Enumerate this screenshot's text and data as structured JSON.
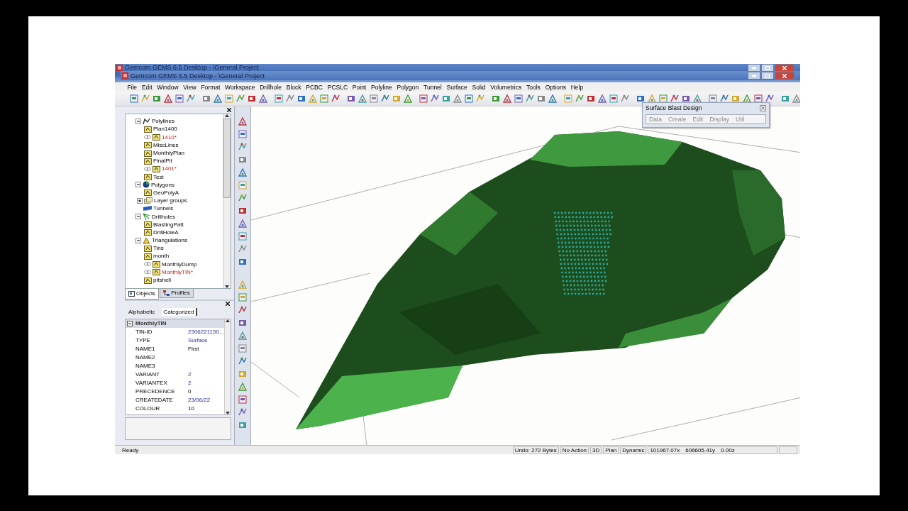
{
  "window": {
    "title_back": "Gemcom GEMS 6.5 Desktop - \\General Project",
    "title": "Gemcom GEMS 6.5 Desktop - \\General Project"
  },
  "menu": [
    "File",
    "Edit",
    "Window",
    "View",
    "Format",
    "Workspace",
    "Drillhole",
    "Block",
    "PCBC",
    "PCSLC",
    "Point",
    "Polyline",
    "Polygon",
    "Tunnel",
    "Surface",
    "Solid",
    "Volumetrics",
    "Tools",
    "Options",
    "Help"
  ],
  "tree": [
    {
      "label": "Polylines",
      "kind": "polyline",
      "expanded": true,
      "children": [
        {
          "label": "Plan1400",
          "loaded": false,
          "modified": false
        },
        {
          "label": "1410*",
          "loaded": true,
          "modified": true
        },
        {
          "label": "MiscLines",
          "loaded": false,
          "modified": false
        },
        {
          "label": "MonthlyPlan",
          "loaded": false,
          "modified": false
        },
        {
          "label": "FinalPit",
          "loaded": false,
          "modified": false
        },
        {
          "label": "1401*",
          "loaded": true,
          "modified": true
        },
        {
          "label": "Test",
          "loaded": false,
          "modified": false
        }
      ]
    },
    {
      "label": "Polygons",
      "kind": "polygon",
      "expanded": true,
      "children": [
        {
          "label": "GeoPolyA",
          "loaded": false,
          "modified": false
        },
        {
          "label": "Layer groups",
          "kind": "group",
          "expanded": false
        }
      ]
    },
    {
      "label": "Tunnels",
      "kind": "tunnel"
    },
    {
      "label": "Drillholes",
      "kind": "drillhole",
      "expanded": true,
      "children": [
        {
          "label": "BlastingPatt",
          "loaded": false,
          "modified": false
        },
        {
          "label": "DrillHoleA",
          "loaded": false,
          "modified": false
        }
      ]
    },
    {
      "label": "Triangulations",
      "kind": "triangulation",
      "expanded": true,
      "children": [
        {
          "label": "Tins",
          "loaded": false,
          "modified": false
        },
        {
          "label": "month",
          "loaded": false,
          "modified": false
        },
        {
          "label": "MonthlyDump",
          "loaded": true,
          "modified": false
        },
        {
          "label": "MonthlyTIN*",
          "loaded": true,
          "modified": true
        },
        {
          "label": "pitshell",
          "loaded": false,
          "modified": false
        }
      ]
    }
  ],
  "tree_tabs": [
    {
      "label": "Objects",
      "selected": true
    },
    {
      "label": "Profiles",
      "selected": false
    }
  ],
  "properties": {
    "tabs": [
      {
        "label": "Alphabetic",
        "selected": false
      },
      {
        "label": "Categorized",
        "selected": true
      }
    ],
    "category": "MonthlyTIN",
    "expanded": true,
    "rows": [
      {
        "name": "TIN-ID",
        "value": "2306221150...",
        "kind": "link"
      },
      {
        "name": "TYPE",
        "value": "Surface",
        "kind": "link"
      },
      {
        "name": "NAME1",
        "value": "First",
        "kind": "text"
      },
      {
        "name": "NAME2"
      },
      {
        "name": "NAME3"
      },
      {
        "name": "VARIANT",
        "value": "2",
        "kind": "link"
      },
      {
        "name": "VARIANTEX",
        "value": "2",
        "kind": "link"
      },
      {
        "name": "PRECEDENCE",
        "value": "0",
        "kind": "text"
      },
      {
        "name": "CREATEDATE",
        "value": "23/06/22",
        "kind": "link"
      },
      {
        "name": "COLOUR",
        "value": "10",
        "kind": "text"
      }
    ]
  },
  "floating_panel": {
    "title": "Surface Blast Design",
    "menu": [
      "Data",
      "Create",
      "Edit",
      "Display",
      "Util"
    ]
  },
  "status_bar": {
    "message": "Ready",
    "panes": [
      "Undo: 272 Bytes",
      "No Action",
      "3D",
      "Plan",
      "Dynamic"
    ],
    "coordinates": [
      "101967.07x",
      "606605.41y",
      "0.00z"
    ]
  }
}
